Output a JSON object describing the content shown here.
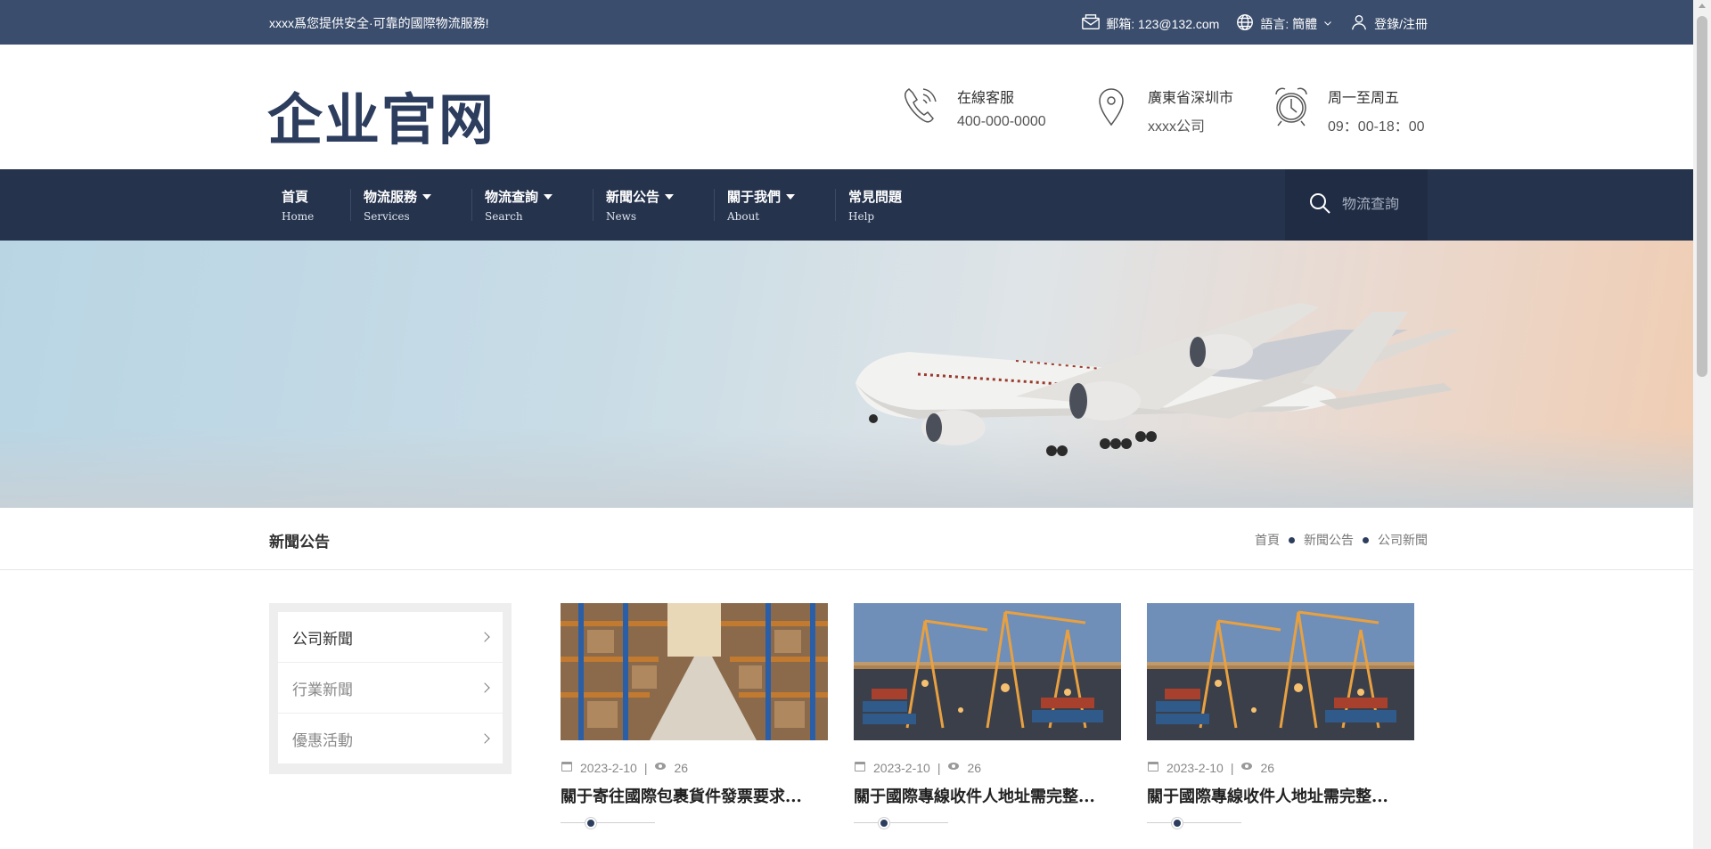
{
  "topbar": {
    "tagline": "xxxx爲您提供安全·可靠的國際物流服務!",
    "email": "郵箱: 123@132.com",
    "language": "語言: 簡體",
    "login": "登錄/注冊"
  },
  "header": {
    "logo": "企业官网",
    "contacts": [
      {
        "label": "在線客服",
        "value": "400-000-0000",
        "icon": "phone-icon"
      },
      {
        "label": "廣東省深圳市",
        "value": "xxxx公司",
        "icon": "location-pin-icon"
      },
      {
        "label": "周一至周五",
        "value": "09：00-18：00",
        "icon": "alarm-clock-icon"
      }
    ]
  },
  "nav": {
    "items": [
      {
        "zh": "首頁",
        "en": "Home",
        "dropdown": false
      },
      {
        "zh": "物流服務",
        "en": "Services",
        "dropdown": true
      },
      {
        "zh": "物流查詢",
        "en": "Search",
        "dropdown": true
      },
      {
        "zh": "新聞公告",
        "en": "News",
        "dropdown": true
      },
      {
        "zh": "關于我們",
        "en": "About",
        "dropdown": true
      },
      {
        "zh": "常見問題",
        "en": "Help",
        "dropdown": false
      }
    ],
    "search_placeholder": "物流查詢"
  },
  "breadcrumb": {
    "title": "新聞公告",
    "items": [
      "首頁",
      "新聞公告",
      "公司新聞"
    ]
  },
  "sidebar": {
    "items": [
      {
        "label": "公司新聞",
        "active": true
      },
      {
        "label": "行業新聞",
        "active": false
      },
      {
        "label": "優惠活動",
        "active": false
      }
    ]
  },
  "news": [
    {
      "date": "2023-2-10",
      "views": "26",
      "title": "關于寄往國際包裹貨件發票要求...",
      "image": "warehouse"
    },
    {
      "date": "2023-2-10",
      "views": "26",
      "title": "關于國際專線收件人地址需完整...",
      "image": "port-cranes"
    },
    {
      "date": "2023-2-10",
      "views": "26",
      "title": "關于國際專線收件人地址需完整...",
      "image": "port-cranes"
    }
  ],
  "colors": {
    "topbar": "#3a4d6d",
    "nav": "#25334d",
    "brand": "#2d3d5e"
  }
}
